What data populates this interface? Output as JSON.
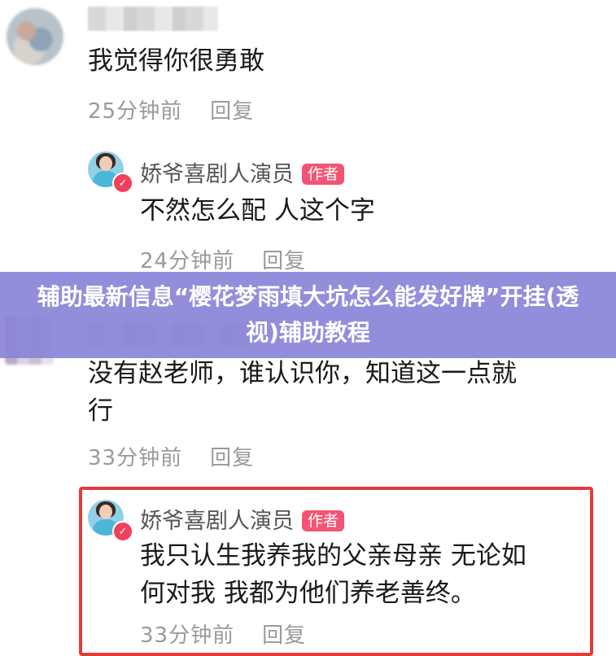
{
  "comments": [
    {
      "text": "我觉得你很勇敢",
      "time": "25分钟前",
      "reply_label": "回复"
    },
    {
      "text_line1": "没有赵老师，谁认识你，知道这一点就",
      "text_line2": "行",
      "time": "33分钟前",
      "reply_label": "回复"
    }
  ],
  "author_replies": [
    {
      "author_name": "娇爷喜剧人演员",
      "badge": "作者",
      "text": "不然怎么配 人这个字",
      "time": "24分钟前",
      "reply_label": "回复"
    },
    {
      "author_name": "娇爷喜剧人演员",
      "badge": "作者",
      "text_line1": "我只认生我养我的父亲母亲 无论如",
      "text_line2": "何对我 我都为他们养老善终。",
      "time": "33分钟前",
      "reply_label": "回复"
    }
  ],
  "banner": {
    "title": "辅助最新信息“樱花梦雨填大坑怎么能发好牌”开挂(透视)辅助教程"
  },
  "colors": {
    "badge": "#f25573",
    "banner": "#8a84d8",
    "highlight_border": "#e53a3a",
    "meta_text": "#9a9a9a"
  }
}
